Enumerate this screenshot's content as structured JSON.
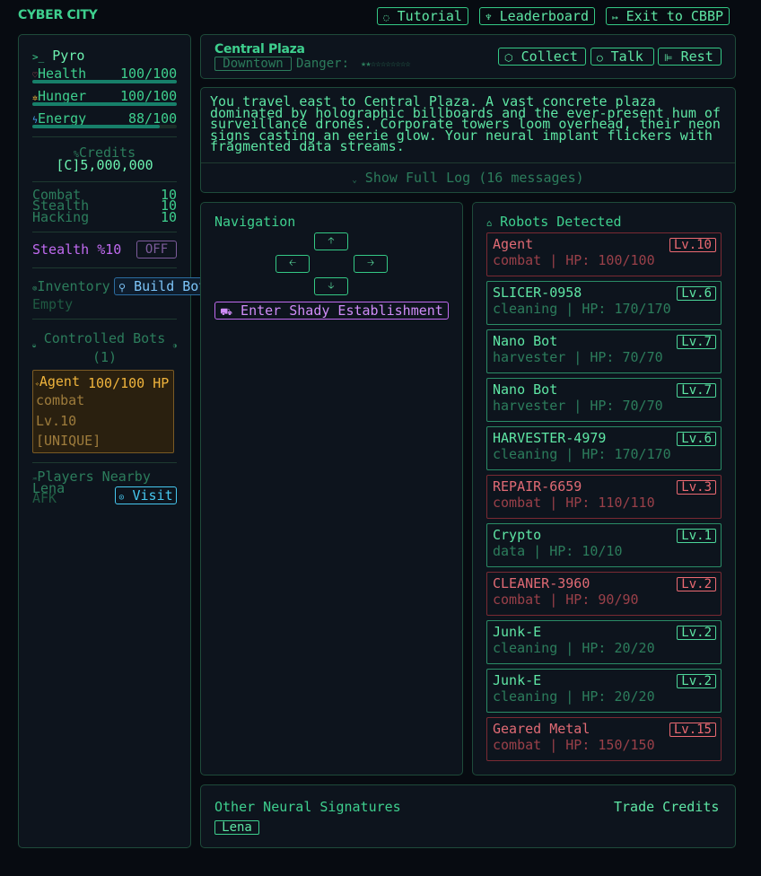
{
  "header": {
    "logo": "CYBER CITY",
    "tutorial": "Tutorial",
    "leaderboard": "Leaderboard",
    "exit": "Exit to CBBP"
  },
  "player": {
    "name": "Pyro",
    "stats": [
      {
        "label": "Health",
        "value": "100/100",
        "fraction": 1.0
      },
      {
        "label": "Hunger",
        "value": "100/100",
        "fraction": 1.0
      },
      {
        "label": "Energy",
        "value": "88/100",
        "fraction": 0.88
      }
    ],
    "credits_label": "Credits",
    "credits_value": "[C]5,000,000",
    "skills": [
      {
        "label": "Combat",
        "value": "10"
      },
      {
        "label": "Stealth",
        "value": "10"
      },
      {
        "label": "Hacking",
        "value": "10"
      }
    ],
    "stealth_label": "Stealth %10",
    "stealth_toggle": "OFF",
    "inventory_label": "Inventory",
    "build_bot": "Build Bot",
    "inventory_empty": "Empty",
    "controlled_label": "Controlled Bots",
    "controlled_count": "(1)",
    "bot": {
      "name": "Agent",
      "hp": "100/100 HP",
      "type": "combat",
      "level": "Lv.10",
      "tag": "[UNIQUE]"
    },
    "players_label": "Players Nearby",
    "nearby": {
      "name": "Lena",
      "status": "AFK",
      "visit": "Visit"
    }
  },
  "location": {
    "name": "Central Plaza",
    "district": "Downtown",
    "danger_label": "Danger:",
    "danger_stars": "★★☆☆☆☆☆☆☆☆",
    "collect": "Collect",
    "talk": "Talk",
    "rest": "Rest"
  },
  "log": {
    "lines": [
      "You travel east to Central Plaza. A vast concrete plaza",
      "dominated by holographic billboards and the ever-present hum of",
      "surveillance drones. Corporate towers loom overhead, their neon",
      "signs casting an eerie glow. Your neural implant flickers with",
      "fragmented data streams."
    ],
    "show_full": "Show Full Log (16 messages)"
  },
  "navigation": {
    "title": "Navigation",
    "up": "🡡",
    "left": "🡠",
    "right": "🡢",
    "down": "🡣",
    "enter": "Enter Shady Establishment"
  },
  "robots": {
    "title": "Robots Detected",
    "items": [
      {
        "name": "Agent",
        "info": "combat | HP: 100/100",
        "level": "Lv.10",
        "hostile": true
      },
      {
        "name": "SLICER-0958",
        "info": "cleaning | HP: 170/170",
        "level": "Lv.6",
        "hostile": false
      },
      {
        "name": "Nano Bot",
        "info": "harvester | HP: 70/70",
        "level": "Lv.7",
        "hostile": false
      },
      {
        "name": "Nano Bot",
        "info": "harvester | HP: 70/70",
        "level": "Lv.7",
        "hostile": false
      },
      {
        "name": "HARVESTER-4979",
        "info": "cleaning | HP: 170/170",
        "level": "Lv.6",
        "hostile": false
      },
      {
        "name": "REPAIR-6659",
        "info": "combat | HP: 110/110",
        "level": "Lv.3",
        "hostile": true
      },
      {
        "name": "Crypto",
        "info": "data | HP: 10/10",
        "level": "Lv.1",
        "hostile": false
      },
      {
        "name": "CLEANER-3960",
        "info": "combat | HP: 90/90",
        "level": "Lv.2",
        "hostile": true
      },
      {
        "name": "Junk-E",
        "info": "cleaning | HP: 20/20",
        "level": "Lv.2",
        "hostile": false
      },
      {
        "name": "Junk-E",
        "info": "cleaning | HP: 20/20",
        "level": "Lv.2",
        "hostile": false
      },
      {
        "name": "Geared Metal",
        "info": "combat | HP: 150/150",
        "level": "Lv.15",
        "hostile": true
      }
    ]
  },
  "signatures": {
    "title": "Other Neural Signatures",
    "trade": "Trade Credits",
    "player": "Lena"
  },
  "colors": {
    "accent": "#3ecf8e",
    "hostile": "#ec6a72",
    "gold": "#f0b43c",
    "purple": "#c06af0",
    "cyan": "#46c8f0"
  }
}
